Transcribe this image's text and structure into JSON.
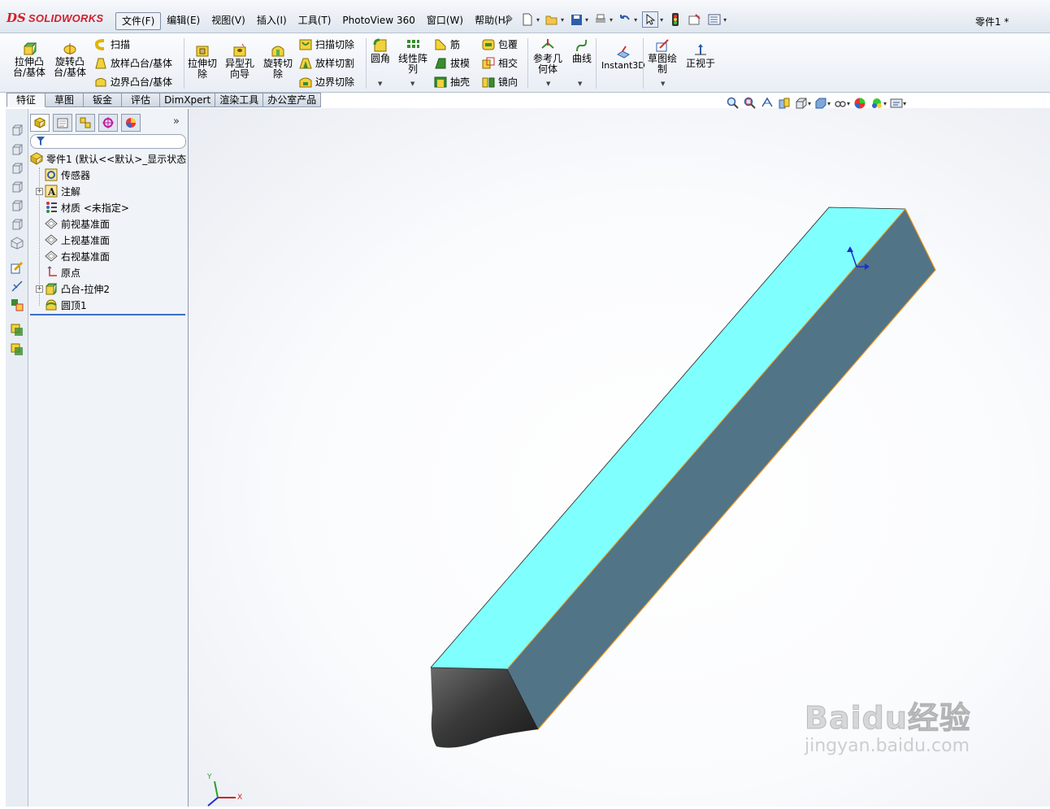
{
  "app": {
    "logo_ds": "DS",
    "logo_word": "SOLIDWORKS",
    "doc_title": "零件1 *"
  },
  "menus": [
    "文件(F)",
    "编辑(E)",
    "视图(V)",
    "插入(I)",
    "工具(T)",
    "PhotoView 360",
    "窗口(W)",
    "帮助(H)"
  ],
  "commands": {
    "extrude_boss": "拉伸凸\n台/基体",
    "revolve_boss": "旋转凸\n台/基体",
    "sweep": "扫描",
    "loft_boss": "放样凸台/基体",
    "boundary_boss": "边界凸台/基体",
    "extrude_cut": "拉伸切\n除",
    "hole_wizard": "异型孔\n向导",
    "revolve_cut": "旋转切\n除",
    "swept_cut": "扫描切除",
    "lofted_cut": "放样切割",
    "boundary_cut": "边界切除",
    "fillet": "圆角",
    "linear_pattern": "线性阵\n列",
    "rib": "筋",
    "draft": "拔模",
    "shell": "抽壳",
    "wrap": "包覆",
    "intersect": "相交",
    "mirror": "镜向",
    "ref_geometry": "参考几\n何体",
    "curves": "曲线",
    "instant3d": "Instant3D",
    "sketch": "草图绘\n制",
    "normal_to": "正视于"
  },
  "tabs": [
    "特征",
    "草图",
    "钣金",
    "评估",
    "DimXpert",
    "渲染工具",
    "办公室产品"
  ],
  "active_tab": "特征",
  "tree": {
    "root": "零件1  (默认<<默认>_显示状态",
    "items": [
      {
        "label": "传感器",
        "expandable": false
      },
      {
        "label": "注解",
        "expandable": true
      },
      {
        "label": "材质 <未指定>",
        "expandable": false
      },
      {
        "label": "前视基准面",
        "expandable": false
      },
      {
        "label": "上视基准面",
        "expandable": false
      },
      {
        "label": "右视基准面",
        "expandable": false
      },
      {
        "label": "原点",
        "expandable": false
      },
      {
        "label": "凸台-拉伸2",
        "expandable": true
      },
      {
        "label": "圆顶1",
        "expandable": false
      }
    ]
  },
  "triad": {
    "y": "Y",
    "x": "X"
  },
  "watermark": {
    "brand": "Baidu经验",
    "url": "jingyan.baidu.com"
  },
  "colors": {
    "top_face": "#80ffff",
    "side_face": "#527487",
    "dome": "#3c3c3c",
    "edge": "#e8941e",
    "accent": "#d3202a"
  }
}
